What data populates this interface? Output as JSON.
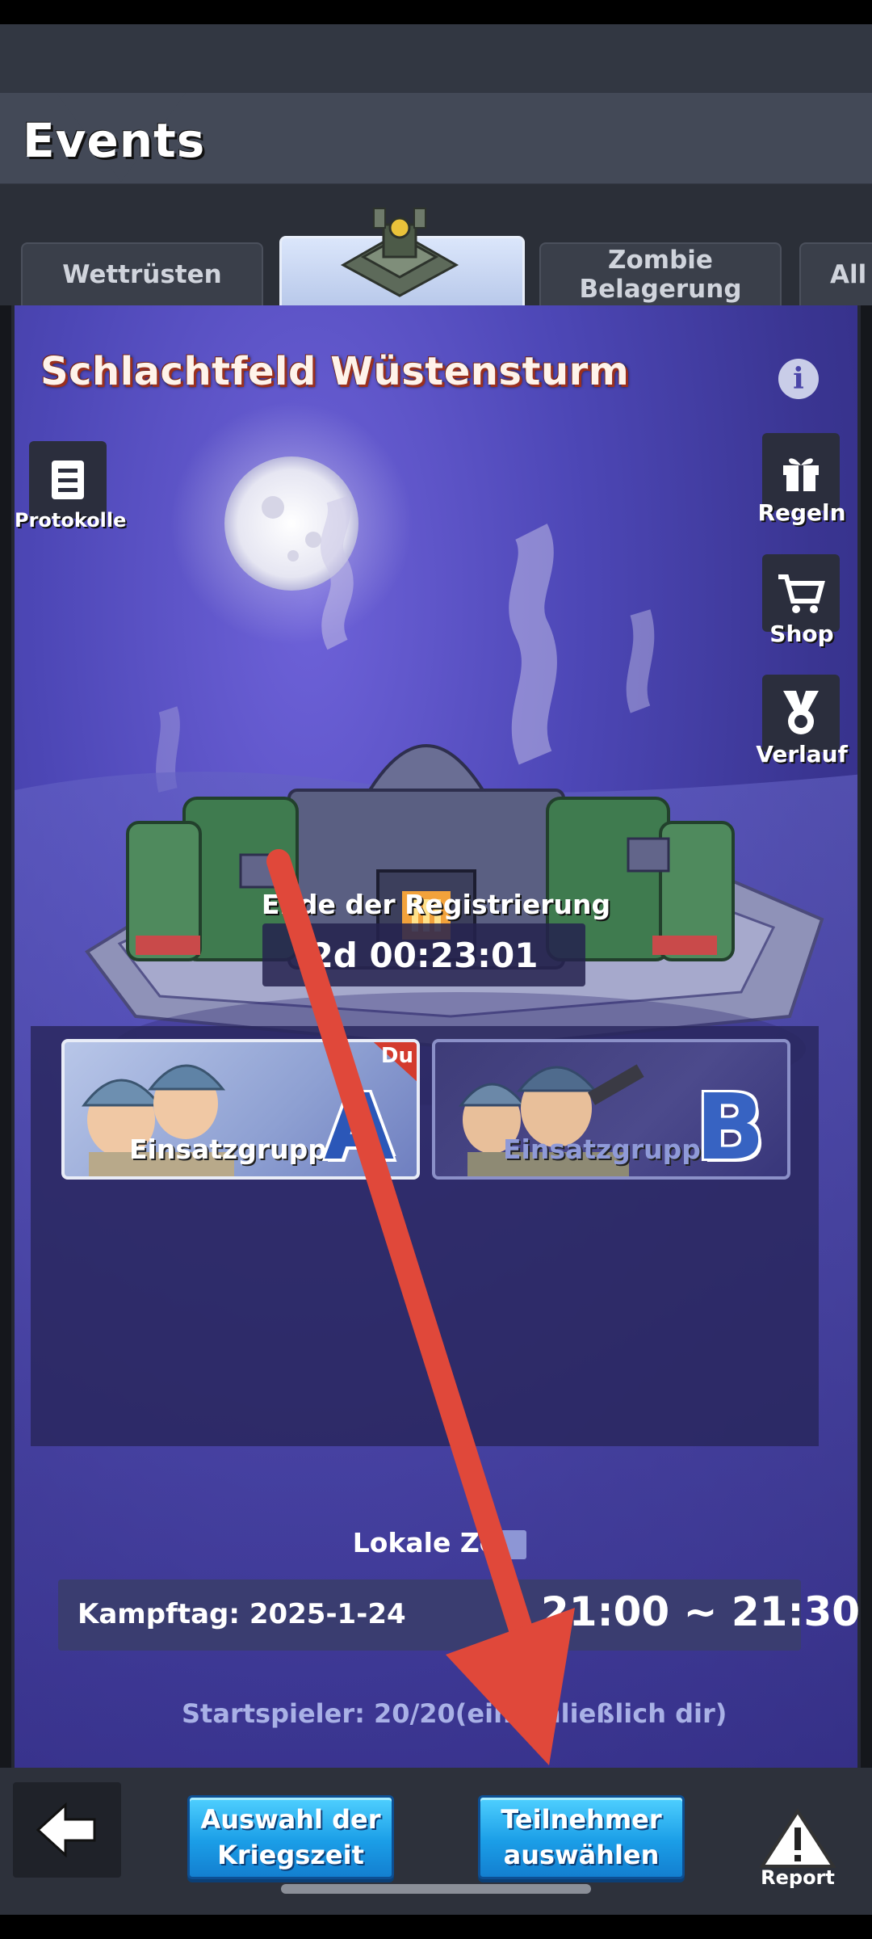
{
  "header": {
    "title": "Events"
  },
  "tabs": [
    {
      "label": "Wettrüsten",
      "active": false
    },
    {
      "label": "",
      "active": true,
      "icon": "fortress-icon"
    },
    {
      "label": "Zombie Belagerung",
      "active": false
    },
    {
      "label": "All",
      "active": false
    }
  ],
  "event": {
    "title": "Schlachtfeld Wüstensturm",
    "side_buttons": {
      "protokolle": "Protokolle",
      "regeln": "Regeln",
      "shop": "Shop",
      "verlauf": "Verlauf"
    },
    "registration": {
      "label": "Ende der Registrierung",
      "timer": "2d 00:23:01"
    },
    "groups": [
      {
        "name": "Einsatzgruppe",
        "letter": "A",
        "badge": "Du",
        "selected": true
      },
      {
        "name": "Einsatzgruppe",
        "letter": "B",
        "selected": false
      }
    ],
    "local_time_label": "Lokale Zeit",
    "battle_day": "Kampftag: 2025-1-24",
    "battle_time": "21:00 ~ 21:30",
    "start_players": "Startspieler:  20/20(einschließlich dir)"
  },
  "bottom": {
    "war_time_button": [
      "Auswahl der",
      "Kriegszeit"
    ],
    "participants_button": [
      "Teilnehmer",
      "auswählen"
    ],
    "report_label": "Report"
  },
  "colors": {
    "panel_bg": "#4d47b6",
    "button_blue": "#1b9ee7",
    "arrow_red": "#e0483a",
    "title_outline": "#9b2f1e"
  }
}
